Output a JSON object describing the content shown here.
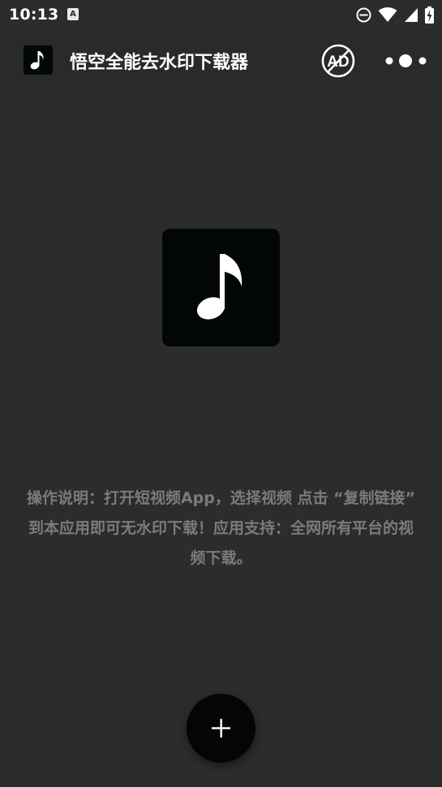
{
  "status_bar": {
    "time": "10:13",
    "notification_icon_letter": "A",
    "icons": [
      "do-not-disturb-icon",
      "wifi-icon",
      "signal-icon",
      "battery-charging-icon"
    ]
  },
  "app_bar": {
    "title": "悟空全能去水印下载器",
    "app_icon": "music-note-icon",
    "no_ad_icon_text": "AD",
    "more_icon": "more-dots-icon"
  },
  "main": {
    "hero_icon": "music-note-icon",
    "instructions": "操作说明：打开短视频App，选择视频 点击 “复制链接” 到本应用即可无水印下载！应用支持：全网所有平台的视频下载。"
  },
  "fab": {
    "icon": "plus-icon"
  },
  "colors": {
    "background": "#2c2c2c",
    "icon_background": "#020706",
    "instruction_text": "#7b7b7b",
    "fab_background": "#050505"
  }
}
